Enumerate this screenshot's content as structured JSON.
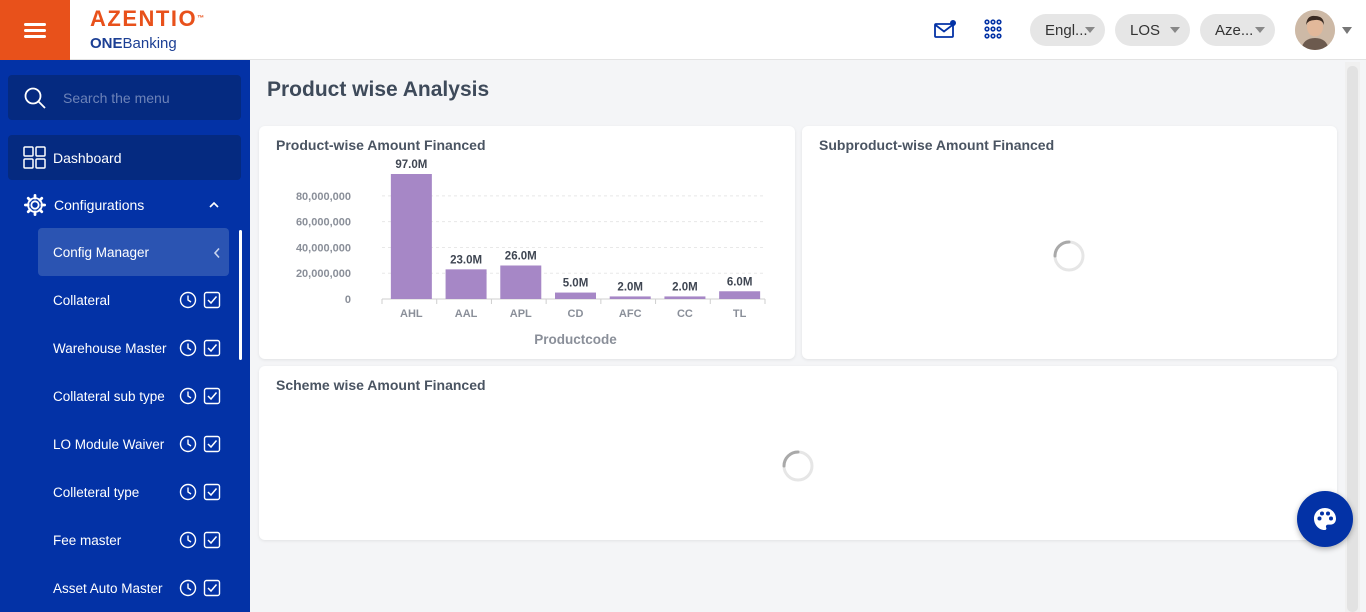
{
  "header": {
    "logo_text": "AZENTIO",
    "logo_sub_bold": "ONE",
    "logo_sub_rest": "Banking",
    "language": "Engl...",
    "module": "LOS",
    "entity": "Aze..."
  },
  "sidebar": {
    "search_placeholder": "Search the menu",
    "dashboard": "Dashboard",
    "configurations": "Configurations",
    "active_sub": "Config Manager",
    "items": [
      {
        "label": "Collateral"
      },
      {
        "label": "Warehouse Master"
      },
      {
        "label": "Collateral sub type"
      },
      {
        "label": "LO Module Waiver"
      },
      {
        "label": "Colleteral type"
      },
      {
        "label": "Fee master"
      },
      {
        "label": "Asset Auto Master"
      }
    ]
  },
  "main": {
    "title": "Product wise Analysis",
    "card1_title": "Product-wise Amount Financed",
    "card2_title": "Subproduct-wise Amount Financed",
    "card3_title": "Scheme wise Amount Financed"
  },
  "colors": {
    "accent": "#e8511b",
    "sidebar": "#0332a6",
    "bar": "#a687c6"
  },
  "chart_data": {
    "type": "bar",
    "title": "Product-wise Amount Financed",
    "xlabel": "Productcode",
    "ylabel": "",
    "categories": [
      "AHL",
      "AAL",
      "APL",
      "CD",
      "AFC",
      "CC",
      "TL"
    ],
    "values": [
      97000000,
      23000000,
      26000000,
      5000000,
      2000000,
      2000000,
      6000000
    ],
    "data_labels": [
      "97.0M",
      "23.0M",
      "26.0M",
      "5.0M",
      "2.0M",
      "2.0M",
      "6.0M"
    ],
    "y_ticks": [
      0,
      20000000,
      40000000,
      60000000,
      80000000
    ],
    "y_tick_labels": [
      "0",
      "20,000,000",
      "40,000,000",
      "60,000,000",
      "80,000,000"
    ],
    "ylim": [
      0,
      97000000
    ],
    "grid": true,
    "legend": "none"
  }
}
